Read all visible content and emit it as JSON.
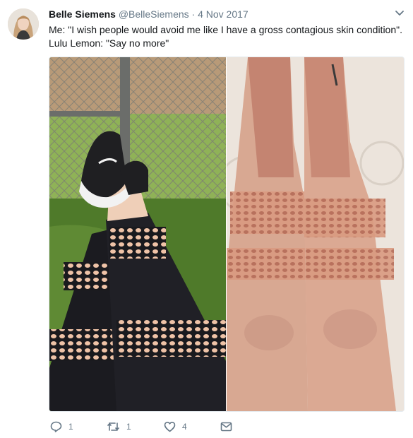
{
  "tweet": {
    "display_name": "Belle Siemens",
    "handle": "@BelleSiemens",
    "separator": "·",
    "date": "4 Nov 2017",
    "text_line_1": "Me: \"I wish people would avoid me like I have a gross contagious skin condition\".",
    "text_line_2": "Lulu Lemon: \"Say no more\"",
    "reply_count": "1",
    "retweet_count": "1",
    "like_count": "4"
  },
  "icons": {
    "caret": "chevron-down-icon",
    "reply": "reply-icon",
    "retweet": "retweet-icon",
    "like": "heart-icon",
    "message": "envelope-icon"
  },
  "colors": {
    "text": "#14171a",
    "muted": "#657786",
    "border": "#e6ecf0"
  }
}
